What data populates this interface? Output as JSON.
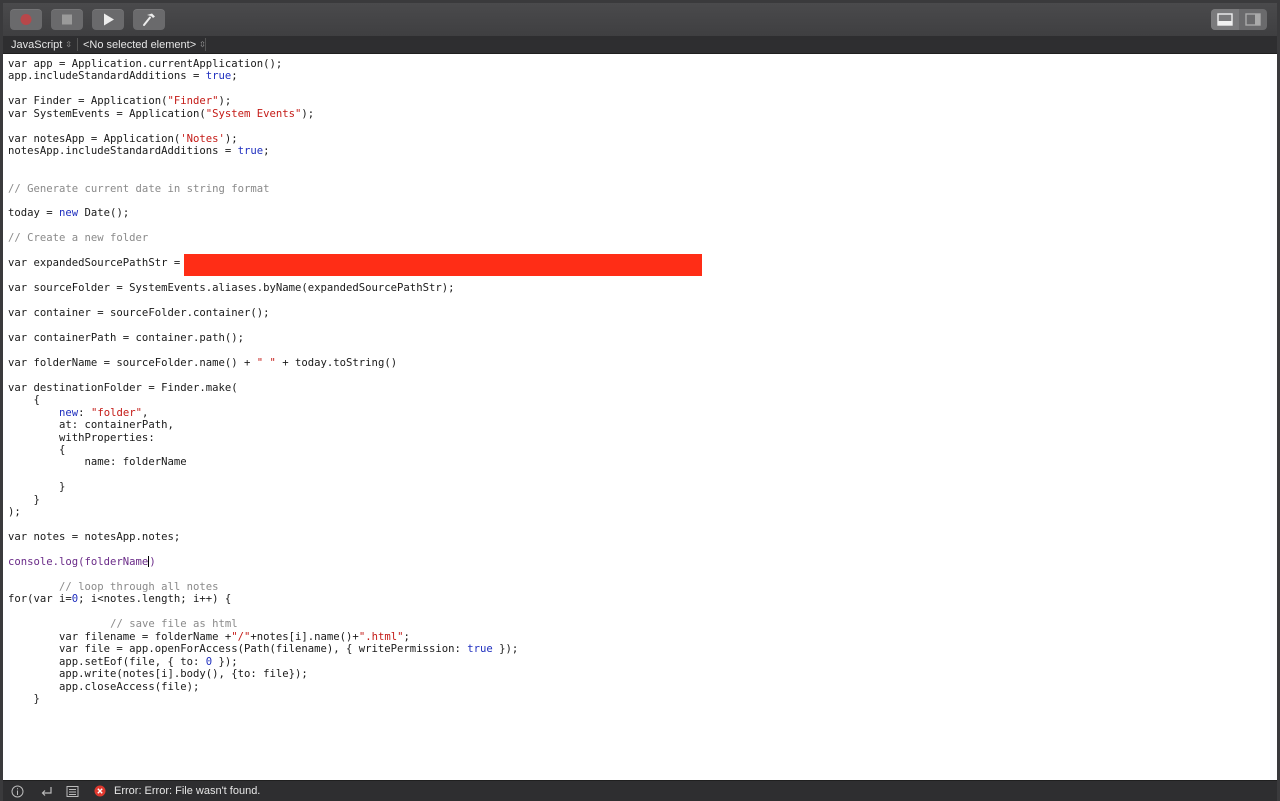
{
  "toolbar": {
    "record_icon": "record-icon",
    "stop_icon": "stop-icon",
    "run_icon": "play-icon",
    "compile_icon": "hammer-icon",
    "layout_icons": [
      "bottom-panel-icon",
      "sidebar-panel-icon"
    ]
  },
  "navbar": {
    "language": "JavaScript",
    "element": "<No selected element>"
  },
  "code": {
    "lines": [
      "var app = Application.currentApplication();",
      "app.includeStandardAdditions = true;",
      "",
      "var Finder = Application(\"Finder\");",
      "var SystemEvents = Application(\"System Events\");",
      "",
      "var notesApp = Application('Notes');",
      "notesApp.includeStandardAdditions = true;",
      "",
      "",
      "// Generate current date in string format",
      "",
      "today = new Date();",
      "",
      "// Create a new folder",
      "",
      "var expandedSourcePathStr = ",
      "",
      "var sourceFolder = SystemEvents.aliases.byName(expandedSourcePathStr);",
      "",
      "var container = sourceFolder.container();",
      "",
      "var containerPath = container.path();",
      "",
      "var folderName = sourceFolder.name() + \" \" + today.toString()",
      "",
      "var destinationFolder = Finder.make(",
      "    {",
      "        new: \"folder\",",
      "        at: containerPath,",
      "        withProperties:",
      "        {",
      "            name: folderName",
      "",
      "        }",
      "    }",
      ");",
      "",
      "var notes = notesApp.notes;",
      "",
      "console.log(folderName)",
      "",
      "        // loop through all notes",
      "for(var i=0; i<notes.length; i++) {",
      "",
      "                // save file as html",
      "        var filename = folderName +\"/\"+notes[i].name()+\".html\";",
      "        var file = app.openForAccess(Path(filename), { writePermission: true });",
      "        app.setEof(file, { to: 0 });",
      "        app.write(notes[i].body(), {to: file});",
      "        app.closeAccess(file);",
      "    }"
    ]
  },
  "statusbar": {
    "icons": [
      "info-icon",
      "return-icon",
      "list-icon"
    ],
    "error_icon": "error-icon",
    "error_text": "Error: Error: File wasn't found."
  },
  "colors": {
    "redaction": "#ff2d16",
    "keyword": "#1f2fbf",
    "string": "#c41a16",
    "comment": "#8a8a8a",
    "error": "#e0392f"
  }
}
